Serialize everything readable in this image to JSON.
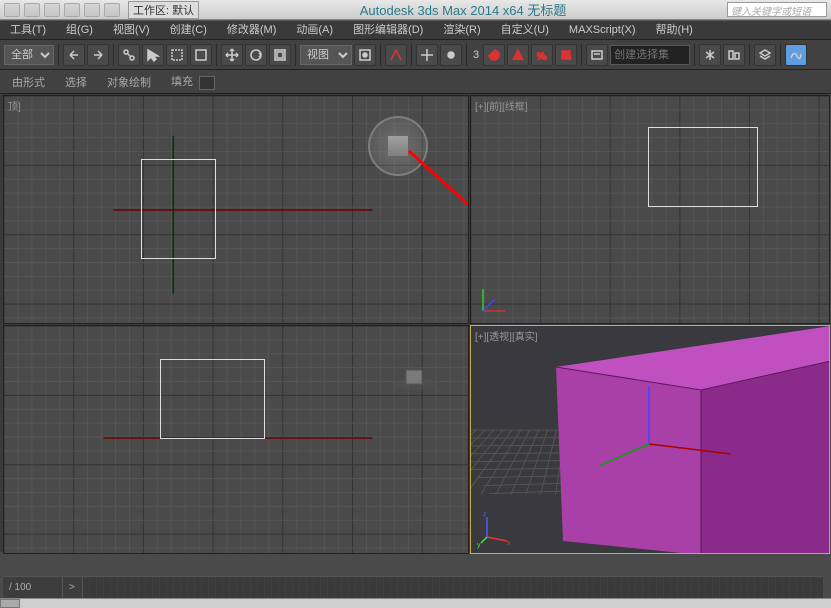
{
  "top": {
    "workspace_label": "工作区: 默认",
    "title": "Autodesk 3ds Max  2014 x64      无标题",
    "search_placeholder": "键入关键字或短语"
  },
  "menu": {
    "tools": "工具(T)",
    "group": "组(G)",
    "view": "视图(V)",
    "create": "创建(C)",
    "modifiers": "修改器(M)",
    "animation": "动画(A)",
    "graph": "图形编辑器(D)",
    "render": "渲染(R)",
    "customize": "自定义(U)",
    "maxscript": "MAXScript(X)",
    "help": "帮助(H)"
  },
  "toolbar": {
    "filter_select_value": "全部",
    "view_select_value": "视图",
    "angle_value": "3",
    "selection_set_placeholder": "创建选择集"
  },
  "subbar": {
    "shape": "由形式",
    "select": "选择",
    "paint": "对象绘制",
    "fill": "填充"
  },
  "viewports": {
    "top_left_label": "顶]",
    "top_right_label": "[+][前][线框]",
    "bottom_left_label": "",
    "bottom_right_label": "[+][透视][真实]"
  },
  "status": {
    "progress": "/ 100",
    "arrow": ">"
  },
  "colors": {
    "mesh_top": "#c050c0",
    "mesh_side": "#8a2b8c",
    "mesh_front": "#a840a8",
    "accent_red": "#ff0000"
  }
}
